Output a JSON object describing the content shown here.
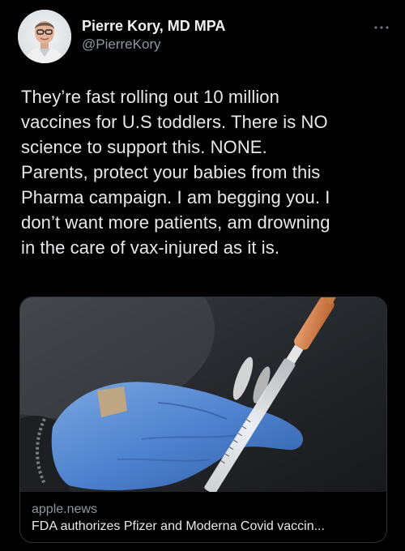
{
  "author": {
    "name": "Pierre Kory, MD MPA",
    "handle": "@PierreKory"
  },
  "tweet": {
    "text": "They’re fast rolling out 10 million\nvaccines for U.S toddlers. There is NO\nscience to support this. NONE.\nParents, protect your babies from this\nPharma campaign. I am begging you. I\ndon’t want more patients, am drowning\nin the care of vax-injured as it is."
  },
  "link_card": {
    "domain": "apple.news",
    "title": "FDA authorizes Pfizer and Moderna Covid vaccin..."
  },
  "icons": {
    "more": "more-horizontal-icon",
    "avatar": "profile-photo"
  },
  "colors": {
    "background": "#000000",
    "text": "#e7e9ea",
    "secondary_text": "#8b98a5",
    "card_border": "#2f3336"
  }
}
